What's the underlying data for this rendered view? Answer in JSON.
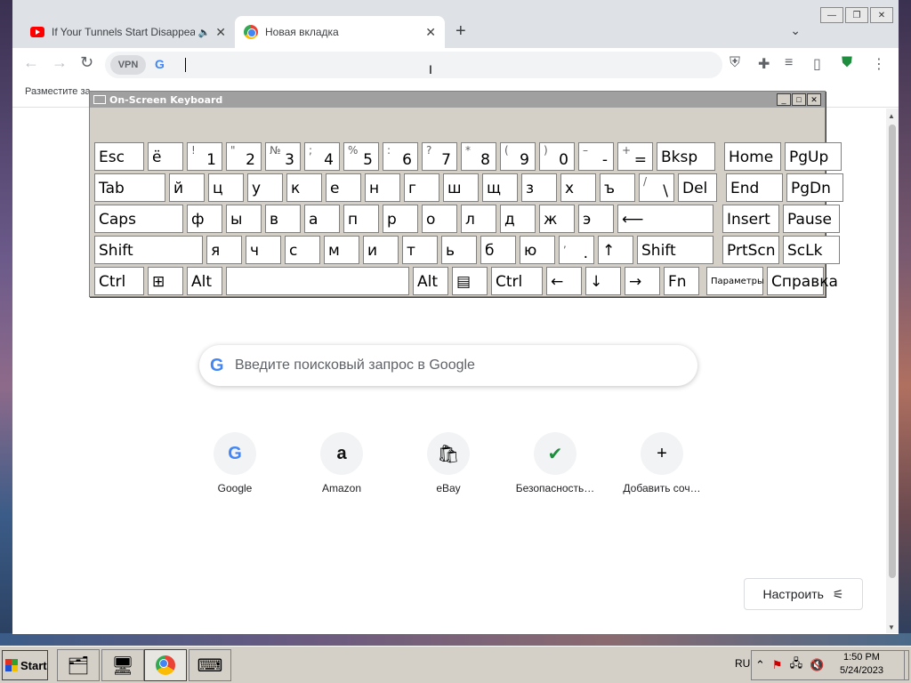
{
  "tabs": [
    {
      "title": "If Your Tunnels Start Disappearing",
      "active": false
    },
    {
      "title": "Новая вкладка",
      "active": true
    }
  ],
  "omnibox": {
    "vpn_label": "VPN",
    "value": ""
  },
  "bookmark_bar": {
    "text": "Разместите за"
  },
  "osk": {
    "title": "On-Screen Keyboard",
    "rows": [
      [
        {
          "main": "Esc"
        },
        {
          "main": "ё"
        },
        {
          "shift": "!",
          "base": "1"
        },
        {
          "shift": "\"",
          "base": "2"
        },
        {
          "shift": "№",
          "base": "3"
        },
        {
          "shift": ";",
          "base": "4"
        },
        {
          "shift": "%",
          "base": "5"
        },
        {
          "shift": ":",
          "base": "6"
        },
        {
          "shift": "?",
          "base": "7"
        },
        {
          "shift": "*",
          "base": "8"
        },
        {
          "shift": "(",
          "base": "9"
        },
        {
          "shift": ")",
          "base": "0"
        },
        {
          "shift": "–",
          "base": "-"
        },
        {
          "shift": "+",
          "base": "="
        },
        {
          "main": "Bksp"
        },
        {
          "main": "Home"
        },
        {
          "main": "PgUp"
        }
      ],
      [
        {
          "main": "Tab"
        },
        {
          "main": "й"
        },
        {
          "main": "ц"
        },
        {
          "main": "у"
        },
        {
          "main": "к"
        },
        {
          "main": "е"
        },
        {
          "main": "н"
        },
        {
          "main": "г"
        },
        {
          "main": "ш"
        },
        {
          "main": "щ"
        },
        {
          "main": "з"
        },
        {
          "main": "х"
        },
        {
          "main": "ъ"
        },
        {
          "shift": "/",
          "base": "\\"
        },
        {
          "main": "Del"
        },
        {
          "main": "End"
        },
        {
          "main": "PgDn"
        }
      ],
      [
        {
          "main": "Caps"
        },
        {
          "main": "ф"
        },
        {
          "main": "ы"
        },
        {
          "main": "в"
        },
        {
          "main": "а"
        },
        {
          "main": "п"
        },
        {
          "main": "р"
        },
        {
          "main": "о"
        },
        {
          "main": "л"
        },
        {
          "main": "д"
        },
        {
          "main": "ж"
        },
        {
          "main": "э"
        },
        {
          "main": "⟵"
        },
        {
          "main": "Insert"
        },
        {
          "main": "Pause"
        }
      ],
      [
        {
          "main": "Shift"
        },
        {
          "main": "я"
        },
        {
          "main": "ч"
        },
        {
          "main": "с"
        },
        {
          "main": "м"
        },
        {
          "main": "и"
        },
        {
          "main": "т"
        },
        {
          "main": "ь"
        },
        {
          "main": "б"
        },
        {
          "main": "ю"
        },
        {
          "shift": ",",
          "base": "."
        },
        {
          "main": "↑"
        },
        {
          "main": "Shift"
        },
        {
          "main": "PrtScn"
        },
        {
          "main": "ScLk"
        }
      ],
      [
        {
          "main": "Ctrl"
        },
        {
          "main": "⊞"
        },
        {
          "main": "Alt"
        },
        {
          "main": ""
        },
        {
          "main": "Alt"
        },
        {
          "main": "▤"
        },
        {
          "main": "Ctrl"
        },
        {
          "main": "←"
        },
        {
          "main": "↓"
        },
        {
          "main": "→"
        },
        {
          "main": "Fn"
        },
        {
          "main": "Параметры"
        },
        {
          "main": "Справка"
        }
      ]
    ]
  },
  "search": {
    "placeholder": "Введите поисковый запрос в Google"
  },
  "shortcuts": [
    {
      "label": "Google",
      "icon": "G"
    },
    {
      "label": "Amazon",
      "icon": "a"
    },
    {
      "label": "eBay",
      "icon": "🛍"
    },
    {
      "label": "Безопасность…",
      "icon": "✔"
    },
    {
      "label": "Добавить соч…",
      "icon": "+"
    }
  ],
  "customize": {
    "label": "Настроить"
  },
  "taskbar": {
    "start_label": "Start",
    "lang": "RU",
    "time": "1:50 PM",
    "date": "5/24/2023"
  }
}
